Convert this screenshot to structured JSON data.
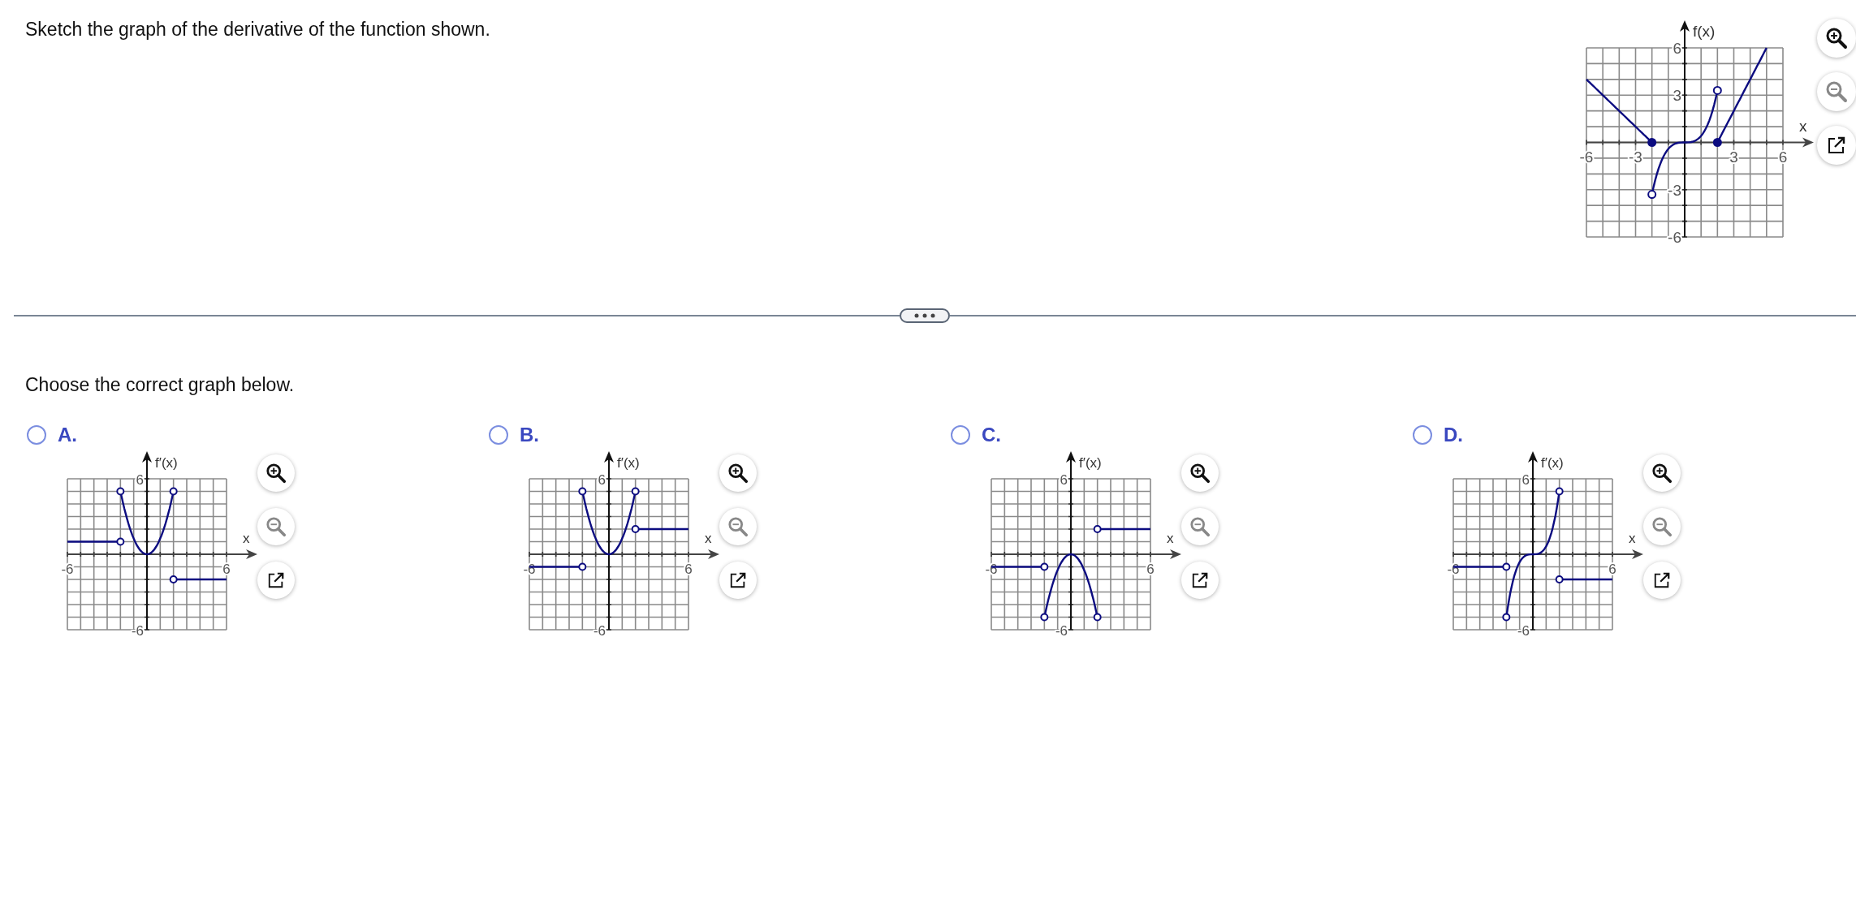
{
  "question": "Sketch the graph of the derivative of the function shown.",
  "given_graph": {
    "y_label": "f(x)",
    "x_label": "x",
    "y_ticks": [
      "6",
      "3",
      "-3",
      "-6"
    ],
    "x_ticks": [
      "-6",
      "-3",
      "3",
      "6"
    ]
  },
  "prompt": "Choose the correct graph below.",
  "options": [
    {
      "letter": "A.",
      "selected": false,
      "graph": {
        "y_label": "f′(x)",
        "x_label": "x",
        "y_ticks": [
          "6",
          "-6"
        ],
        "x_ticks": [
          "-6",
          "6"
        ]
      }
    },
    {
      "letter": "B.",
      "selected": false,
      "graph": {
        "y_label": "f′(x)",
        "x_label": "x",
        "y_ticks": [
          "6",
          "-6"
        ],
        "x_ticks": [
          "-6",
          "6"
        ]
      }
    },
    {
      "letter": "C.",
      "selected": false,
      "graph": {
        "y_label": "f′(x)",
        "x_label": "x",
        "y_ticks": [
          "6",
          "-6"
        ],
        "x_ticks": [
          "-6",
          "6"
        ]
      }
    },
    {
      "letter": "D.",
      "selected": false,
      "graph": {
        "y_label": "f′(x)",
        "x_label": "x",
        "y_ticks": [
          "6",
          "-6"
        ],
        "x_ticks": [
          "-6",
          "6"
        ]
      }
    }
  ]
}
